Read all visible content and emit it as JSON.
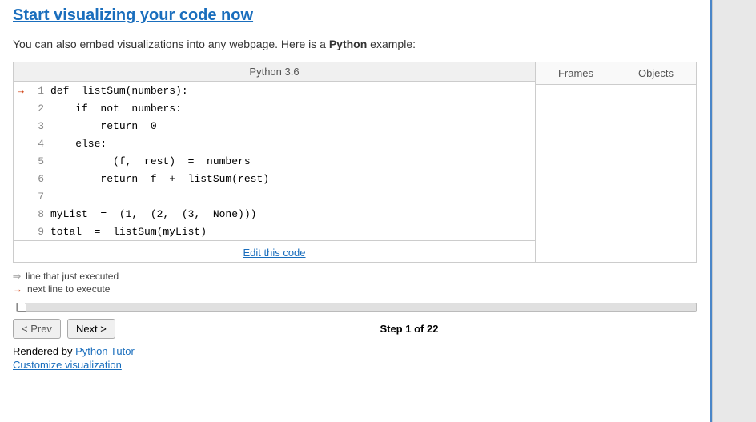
{
  "header": {
    "title": "Start visualizing your code now"
  },
  "embed_text": {
    "before": "You can also embed visualizations into any webpage. Here is a ",
    "highlight": "Python",
    "after": " example:"
  },
  "code_panel": {
    "language_label": "Python 3.6",
    "lines": [
      {
        "arrow": "→",
        "number": "1",
        "code": "def  listSum(numbers):"
      },
      {
        "arrow": "",
        "number": "2",
        "code": "    if  not  numbers:"
      },
      {
        "arrow": "",
        "number": "3",
        "code": "        return  0"
      },
      {
        "arrow": "",
        "number": "4",
        "code": "    else:"
      },
      {
        "arrow": "",
        "number": "5",
        "code": "          (f,  rest)  =  numbers"
      },
      {
        "arrow": "",
        "number": "6",
        "code": "        return  f  +  listSum(rest)"
      },
      {
        "arrow": "",
        "number": "7",
        "code": ""
      },
      {
        "arrow": "",
        "number": "8",
        "code": "myList  =  (1,  (2,  (3,  None)))"
      },
      {
        "arrow": "",
        "number": "9",
        "code": "total  =  listSum(myList)"
      }
    ],
    "edit_link": "Edit this code"
  },
  "right_panel": {
    "frames_label": "Frames",
    "objects_label": "Objects"
  },
  "legend": {
    "gray_arrow_label": "line that just executed",
    "red_arrow_label": "next line to execute"
  },
  "controls": {
    "prev_label": "< Prev",
    "next_label": "Next >",
    "step_text": "Step 1 of 22"
  },
  "footer": {
    "rendered_by": "Rendered by ",
    "python_tutor_link": "Python Tutor",
    "customize_link": "Customize visualization"
  }
}
